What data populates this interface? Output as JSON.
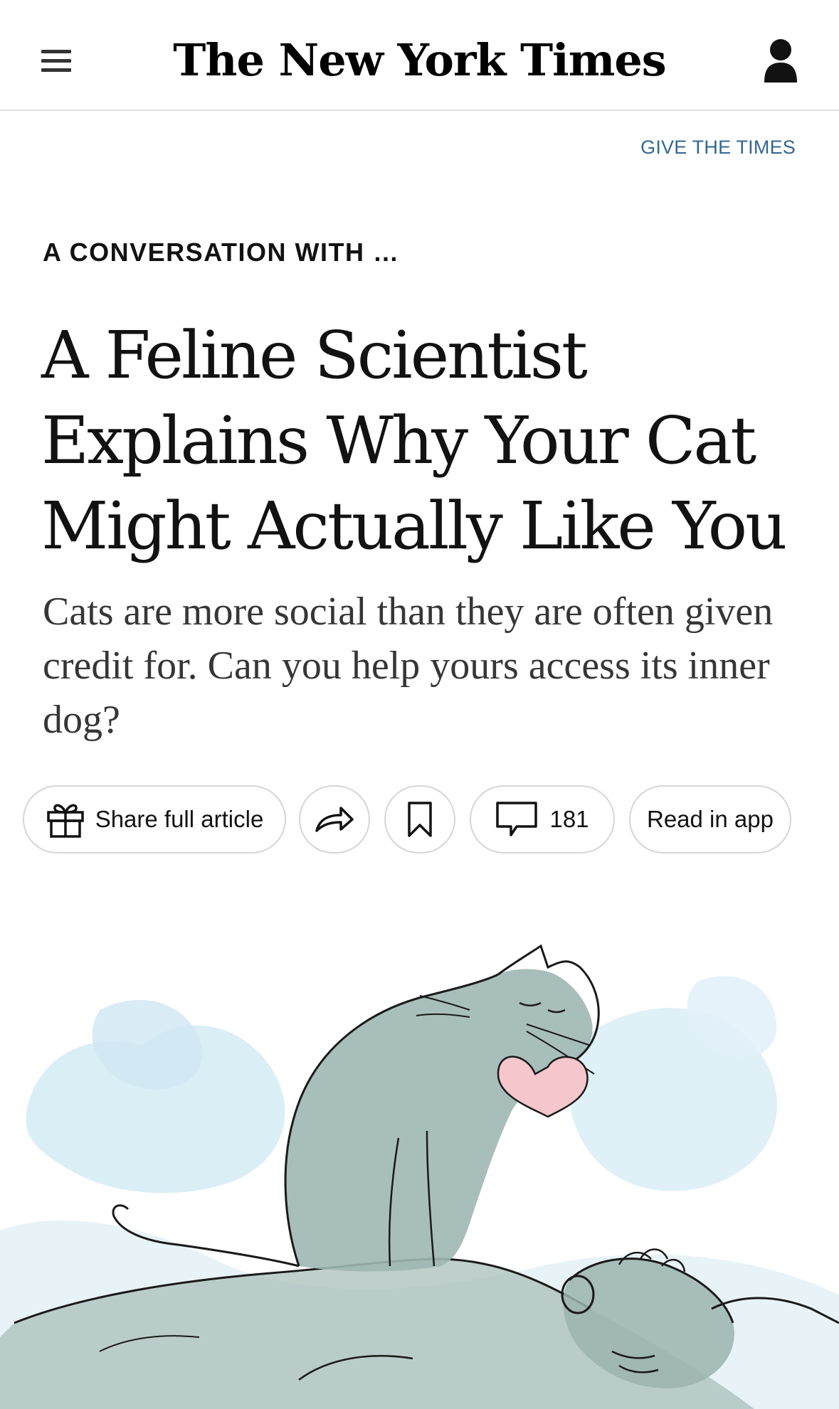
{
  "header": {
    "logo_text": "The New York Times",
    "menu_icon": "hamburger-menu-icon",
    "account_icon": "account-person-icon"
  },
  "gift_link": "GIVE THE TIMES",
  "article": {
    "kicker": "A CONVERSATION WITH …",
    "headline": "A Feline Scientist Explains Why Your Cat Might Actually Like You",
    "summary": "Cats are more social than they are often given credit for. Can you help yours access its inner dog?"
  },
  "toolbar": {
    "share_full_article": "Share full article",
    "share_icon": "share-arrow-icon",
    "save_icon": "bookmark-icon",
    "comments_count": "181",
    "comments_icon": "comment-bubble-icon",
    "read_in_app": "Read in app",
    "gift_icon": "gift-icon"
  },
  "colors": {
    "link_blue": "#326891",
    "divider": "#dfdfdf",
    "pill_border": "#d6d6d6",
    "watercolor_blue": "#cfe8f3",
    "cat_gray": "#9fb7b2",
    "heart_pink": "#f6c6cd"
  }
}
